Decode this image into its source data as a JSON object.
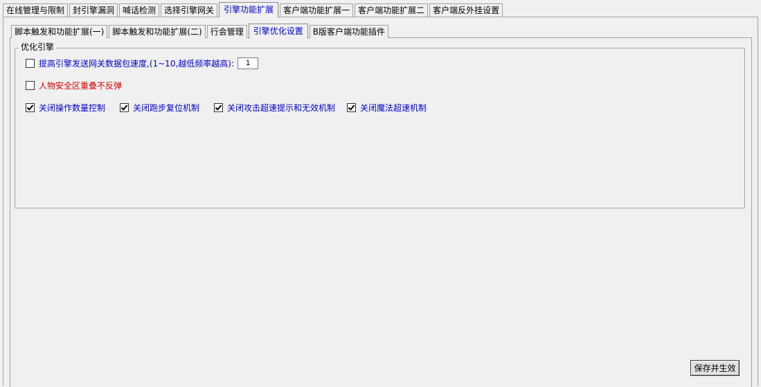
{
  "top_tabs": [
    {
      "label": "在线管理与限制"
    },
    {
      "label": "封引擎漏洞"
    },
    {
      "label": "喊话检测"
    },
    {
      "label": "选择引擎网关"
    },
    {
      "label": "引擎功能扩展",
      "active": true
    },
    {
      "label": "客户端功能扩展一"
    },
    {
      "label": "客户端功能扩展二"
    },
    {
      "label": "客户端反外挂设置"
    }
  ],
  "sub_tabs": [
    {
      "label": "脚本触发和功能扩展(一)"
    },
    {
      "label": "脚本触发和功能扩展(二)"
    },
    {
      "label": "行会管理"
    },
    {
      "label": "引擎优化设置",
      "active": true
    },
    {
      "label": "B版客户端功能插件"
    }
  ],
  "group": {
    "title": "优化引擎",
    "speed_option": {
      "label": "提高引擎发送网关数据包速度,(1~10,越低频率越高):",
      "checked": false,
      "value": "1"
    },
    "no_bounce_option": {
      "label": "人物安全区重叠不反弹",
      "checked": false
    },
    "row3": [
      {
        "label": "关闭操作数量控制",
        "checked": true
      },
      {
        "label": "关闭跑步复位机制",
        "checked": true
      },
      {
        "label": "关闭攻击超速提示和无效机制",
        "checked": true
      },
      {
        "label": "关闭魔法超速机制",
        "checked": true
      }
    ]
  },
  "save_button": {
    "label": "保存并生效"
  },
  "colors": {
    "blue_label": "#0000cc",
    "red_label": "#d40000",
    "background": "#f0f0f0"
  }
}
